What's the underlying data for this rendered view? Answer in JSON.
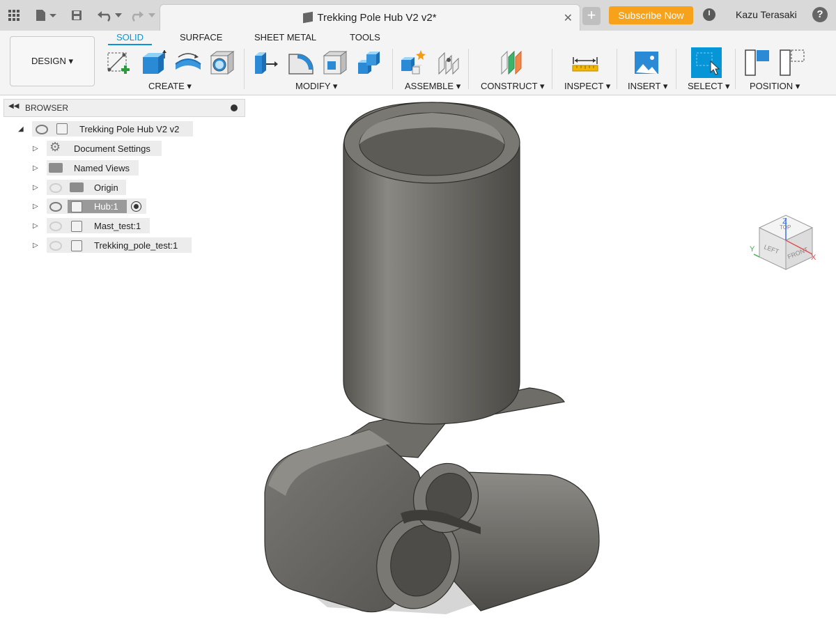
{
  "window": {
    "doc_title": "Trekking Pole Hub V2 v2*",
    "subscribe_label": "Subscribe Now",
    "user_name": "Kazu Terasaki",
    "help_label": "?"
  },
  "toolbar": {
    "workspace_label": "DESIGN ▾",
    "tabs": [
      "SOLID",
      "SURFACE",
      "SHEET METAL",
      "TOOLS"
    ],
    "active_tab": "SOLID",
    "groups": [
      "CREATE ▾",
      "MODIFY ▾",
      "ASSEMBLE ▾",
      "CONSTRUCT ▾",
      "INSPECT ▾",
      "INSERT ▾",
      "SELECT ▾",
      "POSITION ▾"
    ]
  },
  "browser": {
    "title": "BROWSER",
    "root": "Trekking Pole Hub V2 v2",
    "items": [
      {
        "label": "Document Settings",
        "icon": "gear-icon"
      },
      {
        "label": "Named Views",
        "icon": "folder-icon"
      },
      {
        "label": "Origin",
        "icon": "folder-icon",
        "visible": false
      },
      {
        "label": "Hub:1",
        "icon": "component-icon",
        "visible": true,
        "active": true
      },
      {
        "label": "Mast_test:1",
        "icon": "component-icon",
        "visible": false
      },
      {
        "label": "Trekking_pole_test:1",
        "icon": "component-icon",
        "visible": false
      }
    ]
  },
  "viewcube": {
    "top": "TOP",
    "left": "LEFT",
    "front": "FRONT",
    "axis_z": "Z",
    "axis_x": "X",
    "axis_y": "Y"
  },
  "colors": {
    "accent": "#0696d7",
    "subscribe": "#f7a21b",
    "model": "#6d6b66"
  }
}
